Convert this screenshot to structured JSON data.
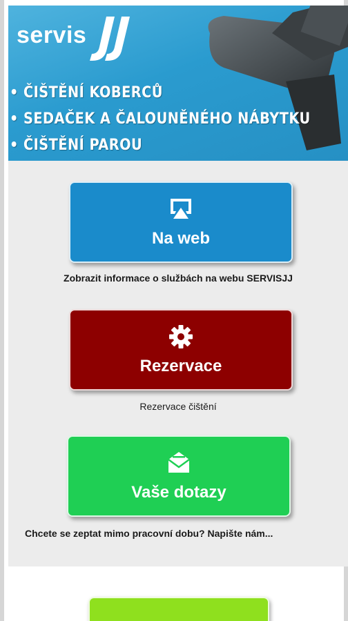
{
  "banner": {
    "logo_text": "servis",
    "lines": [
      "• ČIŠTĚNÍ KOBERCŮ",
      "• SEDAČEK A ČALOUNĚNÉHO NÁBYTKU",
      "• ČIŠTĚNÍ PAROU"
    ]
  },
  "buttons": {
    "web": {
      "label": "Na web",
      "caption": "Zobrazit informace o službách na webu SERVISJJ",
      "icon": "airplay-icon",
      "color": "#1a8bcb"
    },
    "reservation": {
      "label": "Rezervace",
      "caption": "Rezervace čištění",
      "icon": "gear-icon",
      "color": "#8d0000"
    },
    "questions": {
      "label": "Vaše dotazy",
      "caption": "Chcete se zeptat mimo pracovní dobu? Napište nám...",
      "icon": "envelope-icon",
      "color": "#1fcf54"
    },
    "bottom": {
      "color": "#8fe01e"
    }
  }
}
